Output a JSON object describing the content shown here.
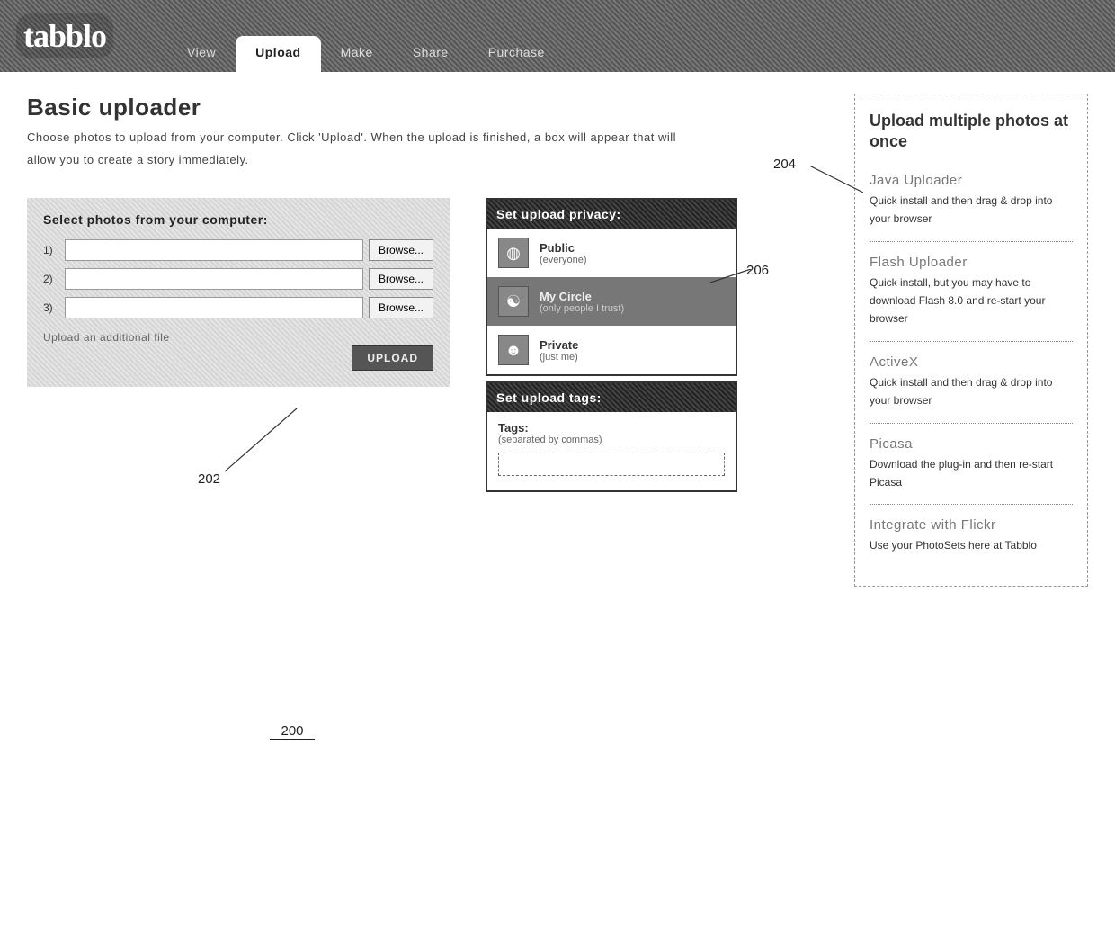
{
  "brand": "tabblo",
  "nav": {
    "items": [
      {
        "label": "View",
        "active": false
      },
      {
        "label": "Upload",
        "active": true
      },
      {
        "label": "Make",
        "active": false
      },
      {
        "label": "Share",
        "active": false
      },
      {
        "label": "Purchase",
        "active": false
      }
    ]
  },
  "page": {
    "title": "Basic uploader",
    "intro": "Choose photos to upload from your computer. Click 'Upload'. When the upload is finished, a box will appear that will allow you to create a story immediately."
  },
  "select": {
    "heading": "Select photos from your computer:",
    "rows": [
      {
        "num": "1)",
        "value": ""
      },
      {
        "num": "2)",
        "value": ""
      },
      {
        "num": "3)",
        "value": ""
      }
    ],
    "browse_label": "Browse...",
    "additional": "Upload an additional file",
    "upload_label": "UPLOAD"
  },
  "privacy": {
    "heading": "Set upload privacy:",
    "options": [
      {
        "label": "Public",
        "sub": "(everyone)",
        "selected": false
      },
      {
        "label": "My Circle",
        "sub": "(only people I trust)",
        "selected": true
      },
      {
        "label": "Private",
        "sub": "(just me)",
        "selected": false
      }
    ]
  },
  "tags": {
    "heading": "Set upload tags:",
    "label": "Tags:",
    "hint": "(separated by commas)",
    "value": ""
  },
  "sidebar": {
    "heading": "Upload multiple photos at once",
    "items": [
      {
        "title": "Java Uploader",
        "desc": "Quick install and then drag & drop into your browser"
      },
      {
        "title": "Flash Uploader",
        "desc": "Quick install, but you may have to download Flash 8.0 and re-start your browser"
      },
      {
        "title": "ActiveX",
        "desc": "Quick install and then drag & drop into your browser"
      },
      {
        "title": "Picasa",
        "desc": "Download the plug-in and then re-start Picasa"
      },
      {
        "title": "Integrate with Flickr",
        "desc": "Use your PhotoSets here at Tabblo"
      }
    ]
  },
  "callouts": {
    "c200": "200",
    "c202": "202",
    "c204": "204",
    "c206": "206"
  }
}
